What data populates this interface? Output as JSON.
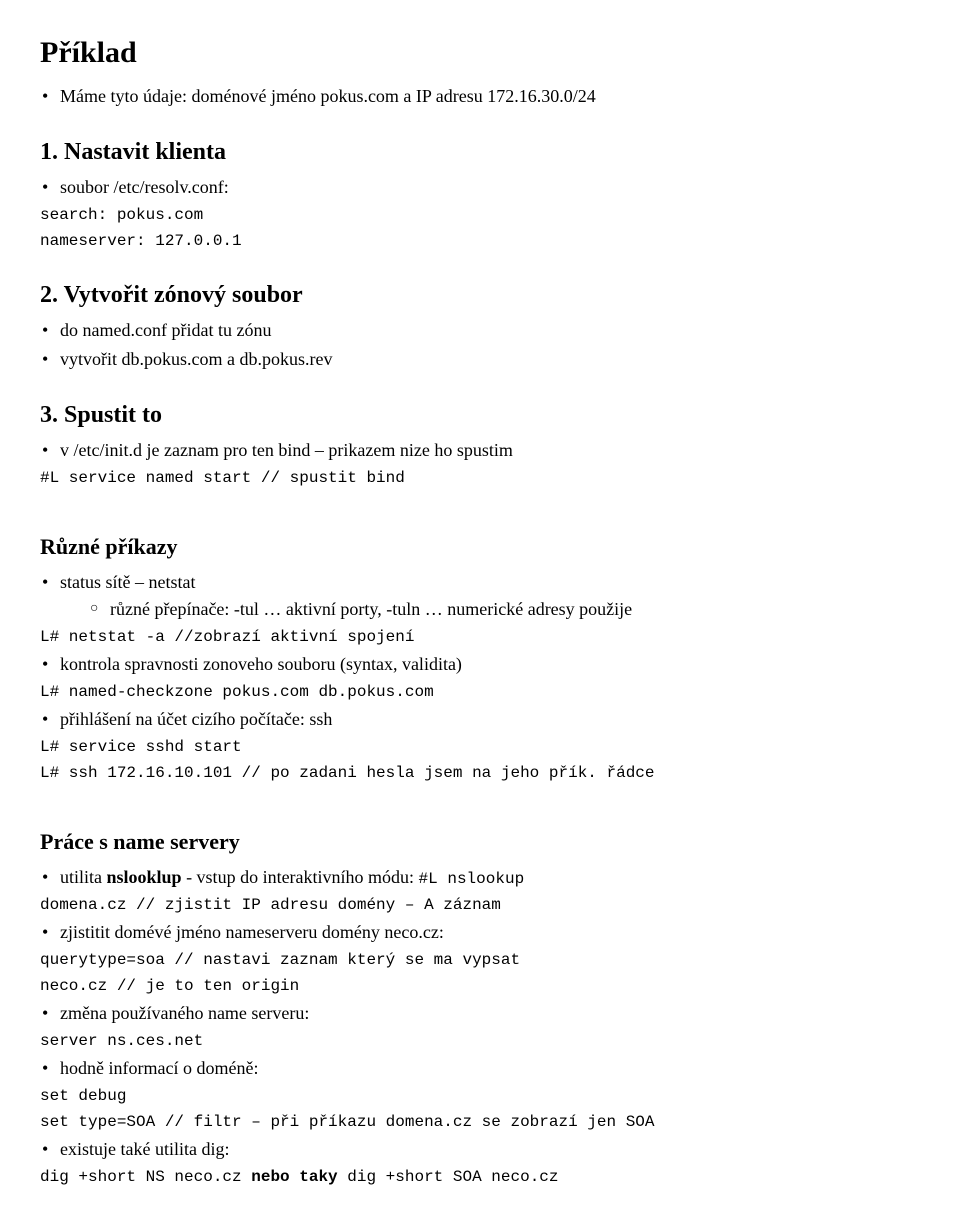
{
  "title": "Příklad",
  "intro_bullets": [
    "Máme tyto údaje: doménové jméno pokus.com a IP adresu 172.16.30.0/24"
  ],
  "section1": {
    "heading": "1. Nastavit klienta",
    "bullets": [
      "soubor /etc/resolv.conf:"
    ],
    "code_lines": [
      "search: pokus.com",
      "nameserver: 127.0.0.1"
    ]
  },
  "section2": {
    "heading": "2. Vytvořit zónový soubor",
    "bullets": [
      "do named.conf přidat tu zónu",
      "vytvořit db.pokus.com a db.pokus.rev"
    ]
  },
  "section3": {
    "heading": "3. Spustit to",
    "bullets": [
      "v /etc/init.d je zaznam pro ten bind – prikazem nize ho spustim"
    ],
    "code_line": "#L service named start        // spustit bind"
  },
  "section4": {
    "heading": "Různé příkazy",
    "bullets": [
      {
        "text": "status sítě – netstat",
        "sub": [
          "různé přepínače: -tul … aktivní porty, -tuln … numerické adresy použije"
        ]
      }
    ],
    "code1": "L# netstat -a              //zobrazí aktivní spojení",
    "bullet2": "kontrola spravnosti zonoveho souboru (syntax, validita)",
    "code2": "L# named-checkzone pokus.com db.pokus.com",
    "bullet3": "přihlášení na účet cizího počítače: ssh",
    "code3_lines": [
      "L# service sshd start",
      "L# ssh 172.16.10.101  // po zadani hesla jsem na jeho přík. řádce"
    ]
  },
  "section5": {
    "heading": "Práce s name servery",
    "bullet1_pre": "utilita ",
    "bullet1_bold": "nslooklup",
    "bullet1_post": " -  vstup do interaktivního módu: ",
    "bullet1_code": "#L nslookup",
    "code1": "domena.cz        // zjistit IP adresu domény – A záznam",
    "bullet2": "zjistitit domévé jméno nameserveru domény neco.cz:",
    "code2_lines": [
      "querytype=soa   // nastavi zaznam který se ma vypsat",
      "neco.cz         // je to ten origin"
    ],
    "bullet3": "změna používaného name serveru:",
    "code3": "server ns.ces.net",
    "bullet4": "hodně informací o doméně:",
    "code4_lines": [
      "set debug",
      "set type=SOA    // filtr – při příkazu domena.cz se zobrazí jen SOA"
    ],
    "bullet5": "existuje také utilita dig:",
    "code5": "dig +short NS neco.cz  nebo taky  dig +short SOA neco.cz",
    "code5_bold1": "nebo taky"
  }
}
